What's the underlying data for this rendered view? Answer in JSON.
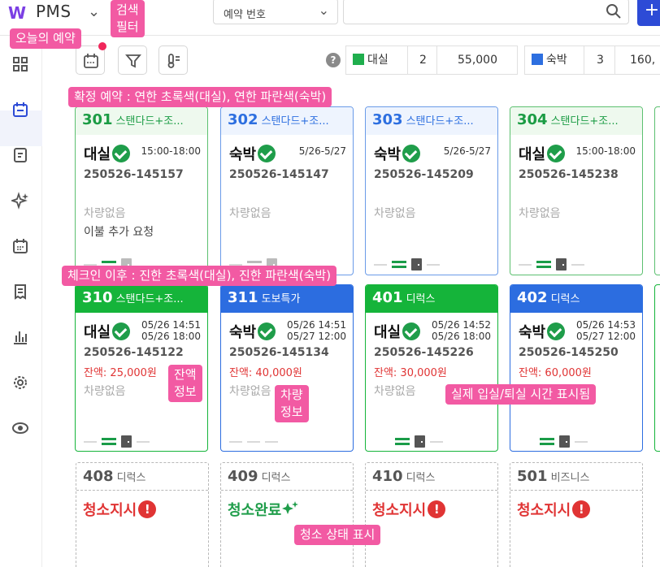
{
  "header": {
    "logo": "W",
    "app_name": "PMS",
    "search_type": "예약 번호",
    "search_placeholder": "",
    "add_label": "+"
  },
  "sidebar": {
    "items": [
      "dashboard-icon",
      "reservation-calendar-icon",
      "report-icon",
      "cleaning-sparkle-icon",
      "calendar-icon",
      "receipt-icon",
      "stats-icon",
      "settings-icon",
      "view-icon"
    ]
  },
  "stats": [
    {
      "color": "#1fae4d",
      "label": "대실",
      "count": "2",
      "amount": "55,000"
    },
    {
      "color": "#2d6fe0",
      "label": "숙박",
      "count": "3",
      "amount": "160,"
    }
  ],
  "cards_row1": [
    {
      "room": "301",
      "type": "스탠다드+조...",
      "kind": "대실",
      "time": "15:00-18:00",
      "number": "250526-145157",
      "car": "차량없음",
      "note": "이불 추가 요청"
    },
    {
      "room": "302",
      "type": "스탠다드+조...",
      "kind": "숙박",
      "time": "5/26-5/27",
      "number": "250526-145147",
      "car": "차량없음",
      "note": ""
    },
    {
      "room": "303",
      "type": "스탠다드+조...",
      "kind": "숙박",
      "time": "5/26-5/27",
      "number": "250526-145209",
      "car": "차량없음",
      "note": ""
    },
    {
      "room": "304",
      "type": "스탠다드+조...",
      "kind": "대실",
      "time": "15:00-18:00",
      "number": "250526-145238",
      "car": "차량없음",
      "note": ""
    }
  ],
  "cards_row2": [
    {
      "room": "310",
      "type": "스탠다드+조...",
      "kind": "대실",
      "time_in": "05/26 14:51",
      "time_out": "05/26 18:00",
      "number": "250526-145122",
      "balance": "잔액: 25,000원",
      "car": "차량없음"
    },
    {
      "room": "311",
      "type": "도보특가",
      "kind": "숙박",
      "time_in": "05/26 14:51",
      "time_out": "05/27 12:00",
      "number": "250526-145134",
      "balance": "잔액: 40,000원",
      "car": "차량없음"
    },
    {
      "room": "401",
      "type": "디럭스",
      "kind": "대실",
      "time_in": "05/26 14:52",
      "time_out": "05/26 18:00",
      "number": "250526-145226",
      "balance": "잔액: 30,000원",
      "car": "차량없음"
    },
    {
      "room": "402",
      "type": "디럭스",
      "kind": "숙박",
      "time_in": "05/26 14:53",
      "time_out": "05/27 12:00",
      "number": "250526-145250",
      "balance": "잔액: 60,000원",
      "car": "차량없음"
    }
  ],
  "cleaning": [
    {
      "room": "408",
      "type": "디럭스",
      "status": "청소지시"
    },
    {
      "room": "409",
      "type": "디럭스",
      "status": "청소완료"
    },
    {
      "room": "410",
      "type": "디럭스",
      "status": "청소지시"
    },
    {
      "room": "501",
      "type": "비즈니스",
      "status": "청소지시"
    }
  ],
  "annotations": {
    "today": "오늘의 예약",
    "search_filter": "검색\n필터",
    "confirmed": "확정 예약 : 연한 초록색(대실), 연한 파란색(숙박)",
    "checked_in": "체크인 이후 : 진한 초록색(대실), 진한 파란색(숙박)",
    "balance_info": "잔액\n정보",
    "car_info": "차량\n정보",
    "actual_time": "실제 입실/퇴실 시간 표시됨",
    "cleaning_status": "청소 상태 표시"
  },
  "colors": {
    "light_green_border": "#5cc070",
    "light_green_text": "#1b9c44",
    "light_blue_border": "#6a9be8",
    "light_blue_text": "#2d6fe0",
    "dark_green": "#15b43a",
    "dark_blue": "#2c6de0",
    "annotation": "#f25aa3",
    "red": "#e03434"
  }
}
